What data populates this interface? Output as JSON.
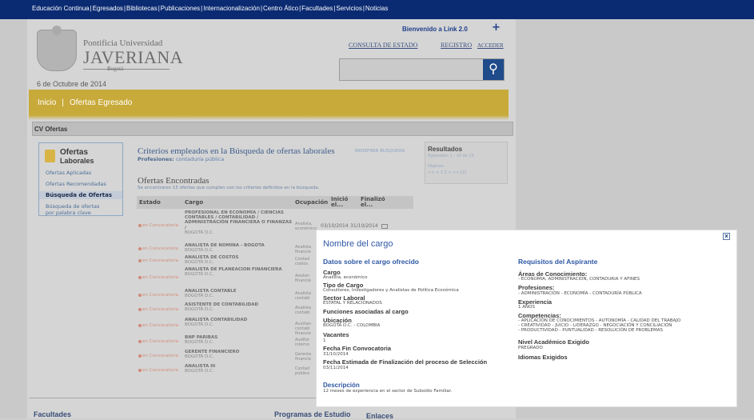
{
  "topbar": {
    "links": [
      "Educación Continua",
      "Egresados",
      "Bibliotecas",
      "Publicaciones",
      "Internacionalización",
      "Centro Ático",
      "Facultades",
      "Servicios",
      "Noticias"
    ]
  },
  "header": {
    "logo_line1": "Pontificia Universidad",
    "logo_line2": "JAVERIANA",
    "logo_line3": "Bogotá",
    "welcome": "Bienvenido a Link 2.0",
    "plus": "+",
    "consulta": "CONSULTA DE ESTADO",
    "registro": "REGISTRO",
    "acceder": "ACCEDER",
    "date": "6 de Octubre de 2014"
  },
  "breadcrumb": {
    "inicio": "Inicio",
    "sep": "|",
    "ofertas": "Ofertas Egresado"
  },
  "cv_bar": "CV Ofertas",
  "sidebar": {
    "title": "Ofertas",
    "subtitle": "Laborales",
    "items": [
      "Ofertas Aplicadas",
      "Ofertas Recomendadas",
      "Búsqueda de Ofertas",
      "Búsqueda de ofertas",
      "por palabra clave"
    ]
  },
  "criteria": {
    "title": "Criterios empleados en la Búsqueda de ofertas laborales",
    "redefinir": "REDEFINIR BUSQUEDA",
    "prof_label": "Profesiones:",
    "prof_value": "contaduría pública"
  },
  "ofertas": {
    "title": "Ofertas Encontradas",
    "subtitle": "Se encontraron 15 ofertas que cumplen con los criterios definidos en la búsqueda.",
    "headers": {
      "estado": "Estado",
      "cargo": "Cargo",
      "ocupacion": "Ocupación",
      "inicio": "Inició el...",
      "finalizo": "Finalizó el..."
    },
    "rows": [
      {
        "estado": "en Convocatoria",
        "cargo": "PROFESIONAL EN ECONOMÍA / CIENCIAS CONTABLES / CONTABILIDAD / ADMINISTRACIÓN FINANCIERA O FINANZAS /",
        "loc": "BOGOTÁ D.C.",
        "ocu": "Analista, económico",
        "ini": "03/10/2014",
        "fin": "31/10/2014"
      },
      {
        "estado": "en Convocatoria",
        "cargo": "ANALISTA DE NOMINA - BOGOTA",
        "loc": "BOGOTÁ D.C.",
        "ocu": "Analista financie",
        "ini": "",
        "fin": ""
      },
      {
        "estado": "en Convocatoria",
        "cargo": "ANALISTA DE COSTOS",
        "loc": "BOGOTÁ D.C.",
        "ocu": "Contad costos",
        "ini": "",
        "fin": ""
      },
      {
        "estado": "en Convocatoria",
        "cargo": "ANALISTA DE PLANEACION FINANCIERA",
        "loc": "BOGOTÁ D.C.",
        "ocu": "Asisten financie",
        "ini": "",
        "fin": ""
      },
      {
        "estado": "en Convocatoria",
        "cargo": "ANALISTA CONTABLE",
        "loc": "BOGOTÁ D.C.",
        "ocu": "Analista contabl",
        "ini": "",
        "fin": ""
      },
      {
        "estado": "en Convocatoria",
        "cargo": "ASISTENTE DE CONTABILIDAD",
        "loc": "BOGOTÁ D.C.",
        "ocu": "Analista contabl",
        "ini": "",
        "fin": ""
      },
      {
        "estado": "en Convocatoria",
        "cargo": "ANALISTA CONTABILIDAD",
        "loc": "BOGOTÁ D.C.",
        "ocu": "Auxilian contabl financie",
        "ini": "",
        "fin": ""
      },
      {
        "estado": "en Convocatoria",
        "cargo": "BNP PARIBAS",
        "loc": "BOGOTÁ D.C.",
        "ocu": "Auditor interno",
        "ini": "",
        "fin": ""
      },
      {
        "estado": "en Convocatoria",
        "cargo": "GERENTE FINANCIERO",
        "loc": "BOGOTÁ D.C.",
        "ocu": "Gerente financie",
        "ini": "",
        "fin": ""
      },
      {
        "estado": "en Convocatoria",
        "cargo": "ANALISTA III",
        "loc": "BOGOTÁ D.C.",
        "ocu": "Contad público",
        "ini": "",
        "fin": ""
      }
    ]
  },
  "results": {
    "title": "Resultados",
    "sub": "Egresados 1 - 10 de 15",
    "pag": "Páginas:",
    "nav": "<< < 1 2 > >> [2]"
  },
  "footer": {
    "facultades": "Facultades",
    "programas": "Programas de Estudio",
    "enlaces": "Enlaces"
  },
  "modal": {
    "close": "x",
    "title": "Nombre del cargo",
    "left_title": "Datos sobre el cargo ofrecido",
    "right_title": "Requisitos del Aspirante",
    "cargo_lbl": "Cargo",
    "cargo_val": "Analista, económico",
    "tipo_lbl": "Tipo de Cargo",
    "tipo_val": "Consultores, Investigadores y Analistas de Política Económica",
    "sector_lbl": "Sector Laboral",
    "sector_val": "ESTATAL Y RELACIONADOS",
    "funciones_lbl": "Funciones asociadas al cargo",
    "ubic_lbl": "Ubicación",
    "ubic_val": "BOGOTÁ D.C. - COLOMBIA",
    "vac_lbl": "Vacantes",
    "vac_val": "1",
    "fecha_fin_lbl": "Fecha Fin Convocatoria",
    "fecha_fin_val": "31/10/2014",
    "fecha_est_lbl": "Fecha Estimada de Finalización del proceso de Selección",
    "fecha_est_val": "03/11/2014",
    "desc_lbl": "Descripción",
    "desc_val": "12 meses de experiencia en el sector de Subsidio Familiar.",
    "areas_lbl": "Áreas de Conocimiento:",
    "areas_val": "- ECONOMIA, ADMINISTRACION, CONTADURIA Y AFINES",
    "prof_lbl": "Profesiones:",
    "prof_val": "- ADMINISTRACIÓN - ECONOMÍA - CONTADURÍA PÚBLICA",
    "exp_lbl": "Experiencia",
    "exp_val": "1 AÑOS",
    "comp_lbl": "Competencias:",
    "comp_val": "- APLICACIÓN DE CONOCIMIENTOS - AUTONOMÍA - CALIDAD DEL TRABAJO\n- CREATIVIDAD - JUICIO - LIDERAZGO - NEGOCIACIÓN Y CONCILIACIÓN\n- PRODUCTIVIDAD - PUNTUALIDAD - RESOLUCIÓN DE PROBLEMAS",
    "nivel_lbl": "Nivel Académico Exigido",
    "nivel_val": "PREGRADO",
    "idiomas_lbl": "Idiomas Exigidos"
  }
}
